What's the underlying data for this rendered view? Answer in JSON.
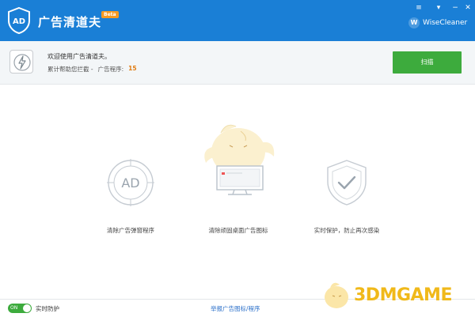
{
  "app": {
    "title": "广告清道夫",
    "badge": "Beta",
    "brand": "WiseCleaner",
    "brand_initial": "W"
  },
  "window_controls": {
    "menu": "≡",
    "minimize": "−",
    "close": "✕",
    "restore": "▾"
  },
  "info": {
    "welcome": "欢迎使用广告清道夫。",
    "stats_label": "累计帮助您拦截 -",
    "programs_label": "广告程序:",
    "programs_count": "15"
  },
  "scan_button": "扫描",
  "features": [
    {
      "label": "清除广告弹窗程序",
      "icon": "ad-block-icon"
    },
    {
      "label": "清除顽固桌面广告图标",
      "icon": "mascot-monitor-icon"
    },
    {
      "label": "实时保护，防止再次感染",
      "icon": "shield-check-icon"
    }
  ],
  "footer": {
    "toggle_state": "ON",
    "realtime_label": "实时防护",
    "report_link": "举报广告图标/程序"
  },
  "watermark": "3DMGAME",
  "colors": {
    "titlebar": "#1a7fd6",
    "scan": "#3dab3d",
    "count": "#e07b10",
    "link": "#2a6fc9"
  }
}
